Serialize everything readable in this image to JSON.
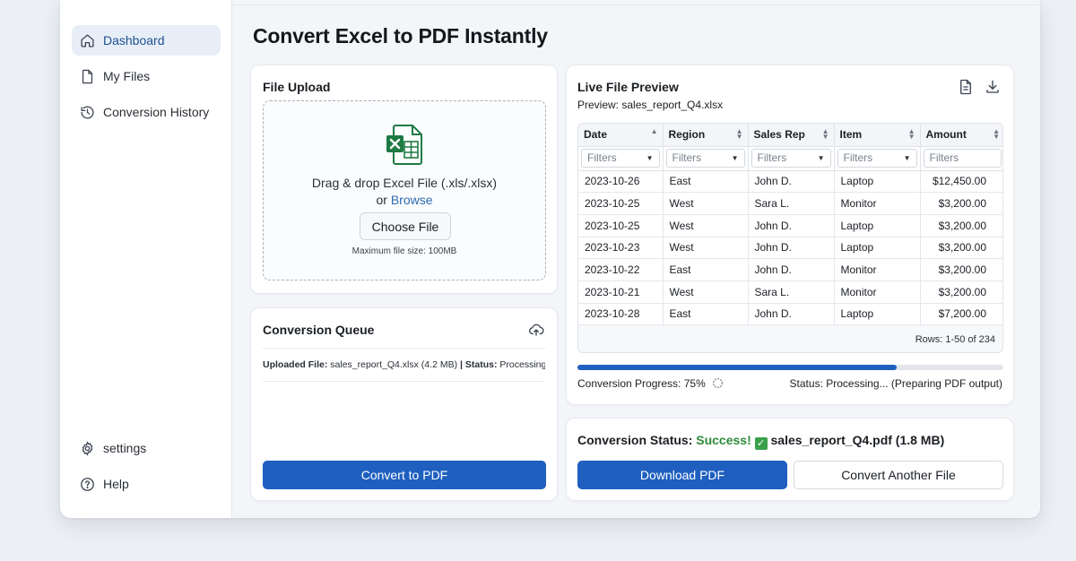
{
  "sidebar": {
    "items": [
      {
        "label": "Dashboard",
        "icon": "home-icon",
        "active": true
      },
      {
        "label": "My Files",
        "icon": "file-icon"
      },
      {
        "label": "Conversion History",
        "icon": "history-icon"
      }
    ],
    "bottom_items": [
      {
        "label": "settings",
        "icon": "gear-icon"
      },
      {
        "label": "Help",
        "icon": "help-icon"
      }
    ]
  },
  "page": {
    "title": "Convert Excel to PDF Instantly"
  },
  "upload": {
    "title": "File Upload",
    "drop_text": "Drag & drop Excel File (.xls/.xlsx)",
    "or_text": "or",
    "browse_label": "Browse",
    "choose_label": "Choose File",
    "max_size": "Maximum file size: 100MB"
  },
  "queue": {
    "title": "Conversion Queue",
    "uploaded_label": "Uploaded File:",
    "uploaded_value": "sales_report_Q4.xlsx (4.2 MB)",
    "separator": "|",
    "status_label": "Status:",
    "status_value": "Processing...",
    "convert_label": "Convert to PDF"
  },
  "preview": {
    "title": "Live File Preview",
    "subtitle": "Preview: sales_report_Q4.xlsx",
    "columns": [
      "Date",
      "Region",
      "Sales Rep",
      "Item",
      "Amount"
    ],
    "filter_placeholder": "Filters",
    "rows": [
      [
        "2023-10-26",
        "East",
        "John D.",
        "Laptop",
        "$12,450.00"
      ],
      [
        "2023-10-25",
        "West",
        "Sara L.",
        "Monitor",
        "$3,200.00"
      ],
      [
        "2023-10-25",
        "West",
        "John D.",
        "Laptop",
        "$3,200.00"
      ],
      [
        "2023-10-23",
        "West",
        "John D.",
        "Laptop",
        "$3,200.00"
      ],
      [
        "2023-10-22",
        "East",
        "John D.",
        "Monitor",
        "$3,200.00"
      ],
      [
        "2023-10-21",
        "West",
        "Sara L.",
        "Monitor",
        "$3,200.00"
      ],
      [
        "2023-10-28",
        "East",
        "John D.",
        "Laptop",
        "$7,200.00"
      ]
    ],
    "rows_count": "Rows: 1-50 of 234",
    "progress_percent": 75,
    "progress_text": "Conversion Progress: 75%",
    "status_text": "Status: Processing... (Preparing PDF output)"
  },
  "result": {
    "status_label": "Conversion Status:",
    "status_value": "Success!",
    "file_text": "sales_report_Q4.pdf (1.8 MB)",
    "download_label": "Download PDF",
    "another_label": "Convert Another File"
  },
  "colors": {
    "primary": "#1e5fbf",
    "success": "#2e8b3a",
    "excel_green": "#1f7a44"
  }
}
